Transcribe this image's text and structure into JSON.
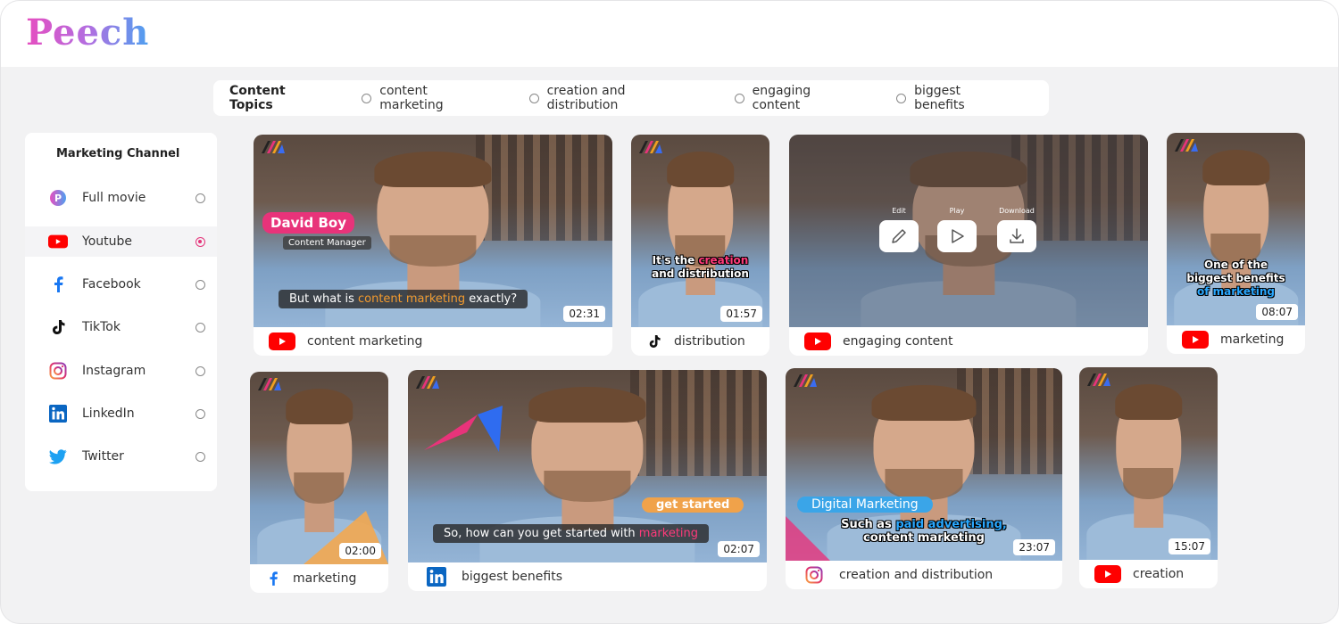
{
  "app": {
    "logo": "Peech"
  },
  "topics": {
    "title": "Content Topics",
    "items": [
      {
        "label": "content marketing"
      },
      {
        "label": "creation and distribution"
      },
      {
        "label": "engaging content"
      },
      {
        "label": "biggest benefits"
      }
    ]
  },
  "sidebar": {
    "title": "Marketing Channel",
    "items": [
      {
        "label": "Full movie",
        "icon": "peech-icon",
        "selected": false
      },
      {
        "label": "Youtube",
        "icon": "youtube-icon",
        "selected": true
      },
      {
        "label": "Facebook",
        "icon": "facebook-icon",
        "selected": false
      },
      {
        "label": "TikTok",
        "icon": "tiktok-icon",
        "selected": false
      },
      {
        "label": "Instagram",
        "icon": "instagram-icon",
        "selected": false
      },
      {
        "label": "LinkedIn",
        "icon": "linkedin-icon",
        "selected": false
      },
      {
        "label": "Twitter",
        "icon": "twitter-icon",
        "selected": false
      }
    ]
  },
  "videos": [
    {
      "title": "content marketing",
      "duration": "02:31",
      "platform": "youtube-icon",
      "name_tag": "David Boy",
      "sub_tag": "Content Manager",
      "caption_pre": "But what is ",
      "caption_hl": "content marketing",
      "caption_post": " exactly?"
    },
    {
      "title": "distribution",
      "duration": "01:57",
      "platform": "tiktok-icon",
      "cap_l1_a": "It's the ",
      "cap_l1_b": "creation",
      "cap_l2": "and distribution"
    },
    {
      "title": "engaging content",
      "platform": "youtube-icon",
      "actions": {
        "edit": "Edit",
        "play": "Play",
        "download": "Download"
      }
    },
    {
      "title": "marketing",
      "duration": "08:07",
      "platform": "youtube-icon",
      "cap_l1": "One of the",
      "cap_l2": "biggest benefits",
      "cap_l3": "of marketing"
    },
    {
      "title": "marketing",
      "duration": "02:00",
      "platform": "facebook-icon"
    },
    {
      "title": "biggest benefits",
      "duration": "02:07",
      "platform": "linkedin-icon",
      "tag": "get started",
      "caption_pre": "So, how can you get started with ",
      "caption_hl": "marketing"
    },
    {
      "title": "creation and distribution",
      "duration": "23:07",
      "platform": "instagram-icon",
      "tag": "Digital Marketing",
      "cap_l1_a": "Such as ",
      "cap_l1_b": "paid advertising,",
      "cap_l2": "content marketing"
    },
    {
      "title": "creation",
      "duration": "15:07",
      "platform": "youtube-icon"
    }
  ],
  "colors": {
    "accent": "#e4337a",
    "youtube": "#ff0000",
    "facebook": "#1877f2",
    "linkedin": "#0a66c2",
    "twitter": "#1da1f2"
  }
}
